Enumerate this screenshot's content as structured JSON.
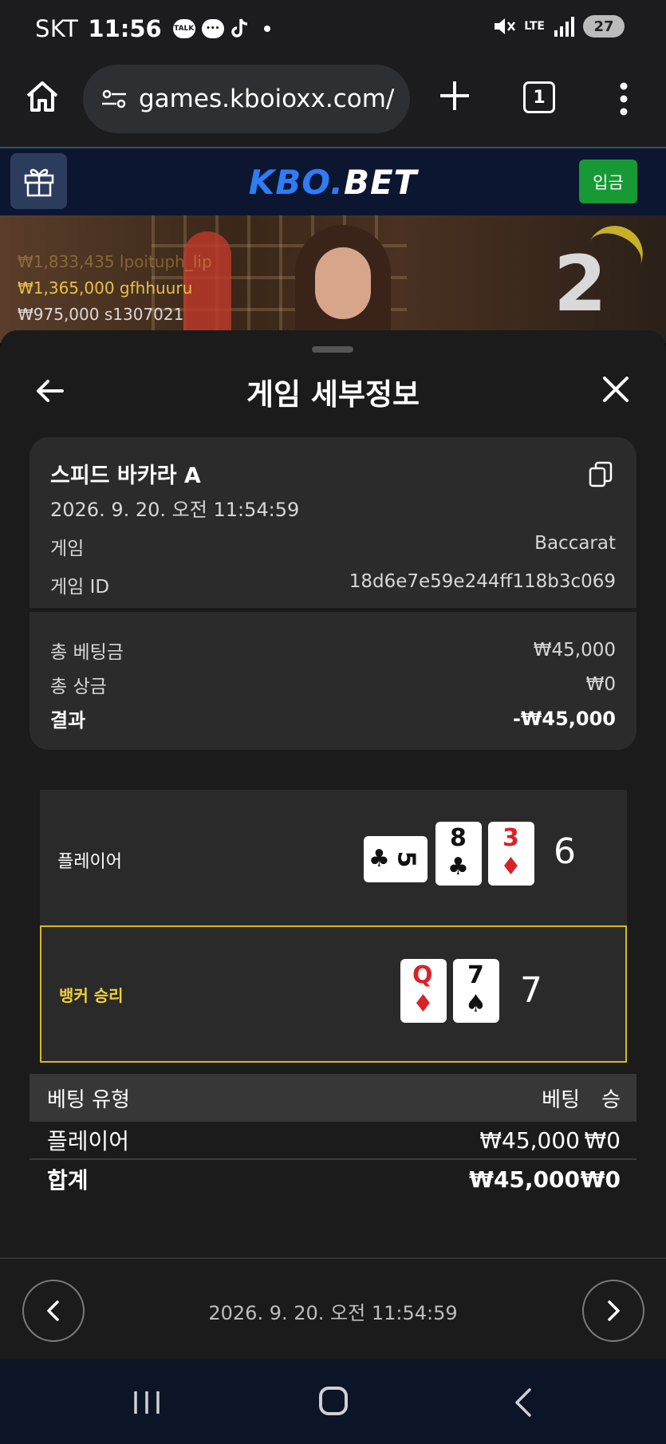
{
  "status_bar": {
    "carrier": "SKT",
    "time": "11:56",
    "notifications": [
      "talk-icon",
      "chat-icon",
      "tiktok-icon"
    ],
    "battery": "27",
    "network": "LTE"
  },
  "browser": {
    "url": "games.kboioxx.com/",
    "tab_count": "1"
  },
  "site": {
    "logo_part1": "KBO.",
    "logo_part2": "BET",
    "deposit_label": "입금"
  },
  "live": {
    "winners": [
      {
        "amount": "₩1,833,435",
        "user": "lpoituph_lip"
      },
      {
        "amount": "₩1,365,000",
        "user": "gfhhuuru"
      },
      {
        "amount": "₩975,000",
        "user": "s1307021"
      }
    ],
    "countdown": "2"
  },
  "sheet": {
    "title": "게임 세부정보",
    "game_name": "스피드 바카라 A",
    "datetime": "2026. 9. 20. 오전 11:54:59",
    "game_label": "게임",
    "game_value": "Baccarat",
    "game_id_label": "게임 ID",
    "game_id_value": "18d6e7e59e244ff118b3c069",
    "total_bet_label": "총 베팅금",
    "total_bet_value": "₩45,000",
    "total_win_label": "총 상금",
    "total_win_value": "₩0",
    "result_label": "결과",
    "result_value": "-₩45,000"
  },
  "hands": {
    "player": {
      "label": "플레이어",
      "score": "6",
      "cards": [
        {
          "rank": "5",
          "suit": "♣",
          "color": "#111111"
        },
        {
          "rank": "8",
          "suit": "♣",
          "color": "#111111"
        },
        {
          "rank": "3",
          "suit": "♦",
          "color": "#d8222a"
        }
      ]
    },
    "banker": {
      "label": "뱅커 승리",
      "score": "7",
      "cards": [
        {
          "rank": "Q",
          "suit": "♦",
          "color": "#d8222a"
        },
        {
          "rank": "7",
          "suit": "♠",
          "color": "#111111"
        }
      ]
    }
  },
  "bet_table": {
    "headers": [
      "베팅 유형",
      "베팅",
      "승"
    ],
    "rows": [
      {
        "type": "플레이어",
        "bet": "₩45,000",
        "win": "₩0"
      }
    ],
    "total": {
      "type": "합계",
      "bet": "₩45,000",
      "win": "₩0"
    }
  },
  "footer": {
    "datetime": "2026. 9. 20. 오전 11:54:59"
  },
  "colors": {
    "accent_blue": "#2e7cf6",
    "deposit_green": "#179a36",
    "banker_highlight": "#d8b91e"
  }
}
